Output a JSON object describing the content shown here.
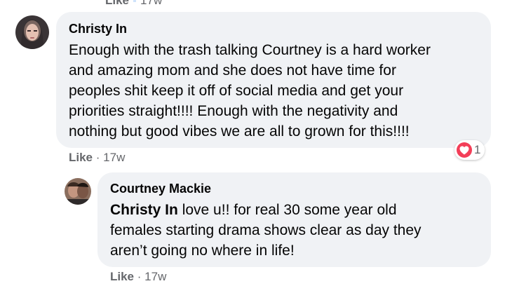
{
  "top_meta": {
    "like_label": "Like",
    "time": "17w"
  },
  "comments": [
    {
      "author": "Christy In",
      "text_lines": [
        "Enough with the trash talking Courtney is a hard worker",
        "and amazing mom and she does not have time for",
        "peoples shit keep it off of social media and get your",
        "priorities straight!!!! Enough with the negativity and",
        "nothing but good vibes we are all to grown for this!!!!"
      ],
      "like_label": "Like",
      "separator": "·",
      "time": "17w",
      "reaction": {
        "icon": "heart-icon",
        "color": "#f33e58",
        "count": "1"
      }
    },
    {
      "author": "Courtney Mackie",
      "mention": "Christy In",
      "text_first_line_rest": " love u!! for real 30 some year old",
      "text_lines": [
        "females starting drama shows clear as day they",
        "aren’t going no where in life!"
      ],
      "like_label": "Like",
      "separator": "·",
      "time": "17w"
    }
  ],
  "colors": {
    "bubble_bg": "#f0f2f5",
    "meta_text": "#65676b",
    "body_text": "#050505"
  }
}
